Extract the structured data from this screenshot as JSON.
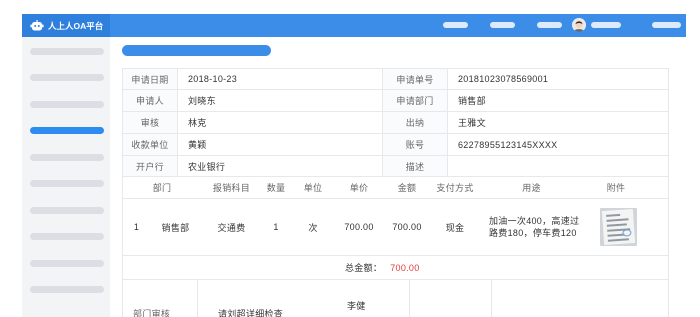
{
  "app": {
    "title": "人上人OA平台",
    "logo_icon": "robot-icon"
  },
  "icons": {
    "avatar": "user-avatar-icon",
    "attachment": "receipt-photo"
  },
  "colors": {
    "brand": "#3c8de8",
    "brand_dark": "#2f80dc",
    "active_nav": "#2d8cf0",
    "total_value": "#e4393c"
  },
  "sidebar": {
    "active_item_index": 3
  },
  "form": {
    "rows": [
      {
        "label1": "申请日期",
        "value1": "2018-10-23",
        "label2": "申请单号",
        "value2": "20181023078569001"
      },
      {
        "label1": "申请人",
        "value1": "刘晓东",
        "label2": "申请部门",
        "value2": "销售部"
      },
      {
        "label1": "审核",
        "value1": "林克",
        "label2": "出纳",
        "value2": "王雅文"
      },
      {
        "label1": "收款单位",
        "value1": "黄颖",
        "label2": "账号",
        "value2": "62278955123145XXXX"
      },
      {
        "label1": "开户行",
        "value1": "农业银行",
        "label2": "描述",
        "value2": ""
      }
    ]
  },
  "expense_items": {
    "headers": [
      "部门",
      "报销科目",
      "数量",
      "单位",
      "单价",
      "金额",
      "支付方式",
      "用途",
      "附件"
    ],
    "rows": [
      {
        "index": "1",
        "department": "销售部",
        "subject": "交通费",
        "quantity": "1",
        "unit": "次",
        "unit_price": "700.00",
        "amount": "700.00",
        "payment_method": "现金",
        "purpose": "加油一次400，高速过路费180，停车费120"
      }
    ]
  },
  "total": {
    "label": "总金额：",
    "value": "700.00"
  },
  "approval": {
    "label": "部门审核",
    "comment": "请刘超详细检查",
    "approver": "李健"
  }
}
